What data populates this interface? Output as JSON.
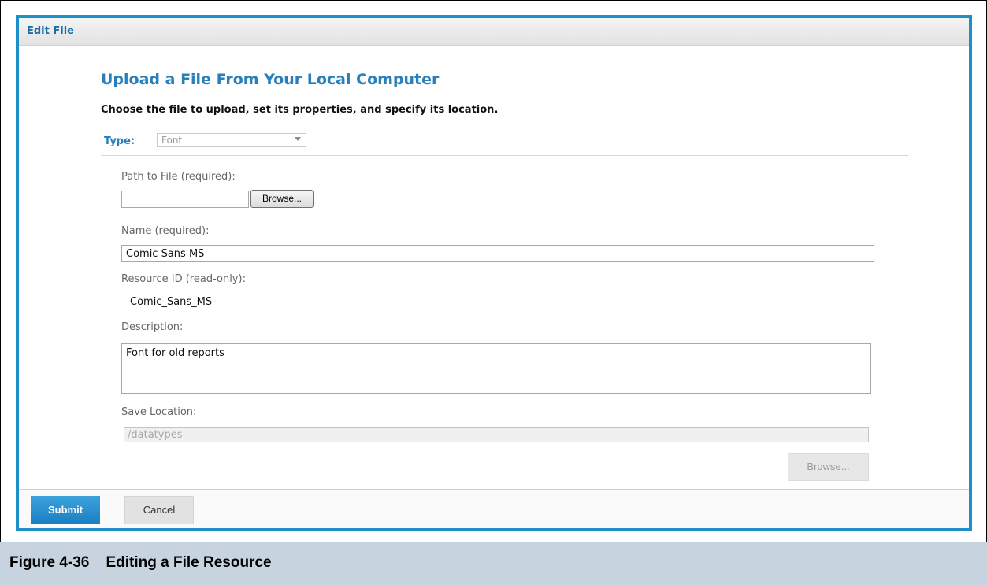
{
  "dialog": {
    "title": "Edit File"
  },
  "form": {
    "heading": "Upload a File From Your Local Computer",
    "instructions": "Choose the file to upload, set its properties, and specify its location.",
    "type_label": "Type:",
    "type_value": "Font",
    "path_label": "Path to File (required):",
    "path_value": "",
    "browse_label": "Browse...",
    "name_label": "Name (required):",
    "name_value": "Comic Sans MS",
    "resource_id_label": "Resource ID (read-only):",
    "resource_id_value": "Comic_Sans_MS",
    "description_label": "Description:",
    "description_value": "Font for old reports",
    "save_location_label": "Save Location:",
    "save_location_value": "/datatypes",
    "location_browse_label": "Browse..."
  },
  "footer": {
    "submit_label": "Submit",
    "cancel_label": "Cancel"
  },
  "caption": {
    "text": "Figure 4-36    Editing a File Resource"
  },
  "colors": {
    "accent": "#1e90c8",
    "heading": "#2a7fba",
    "caption_bg": "#c8d3e0"
  }
}
